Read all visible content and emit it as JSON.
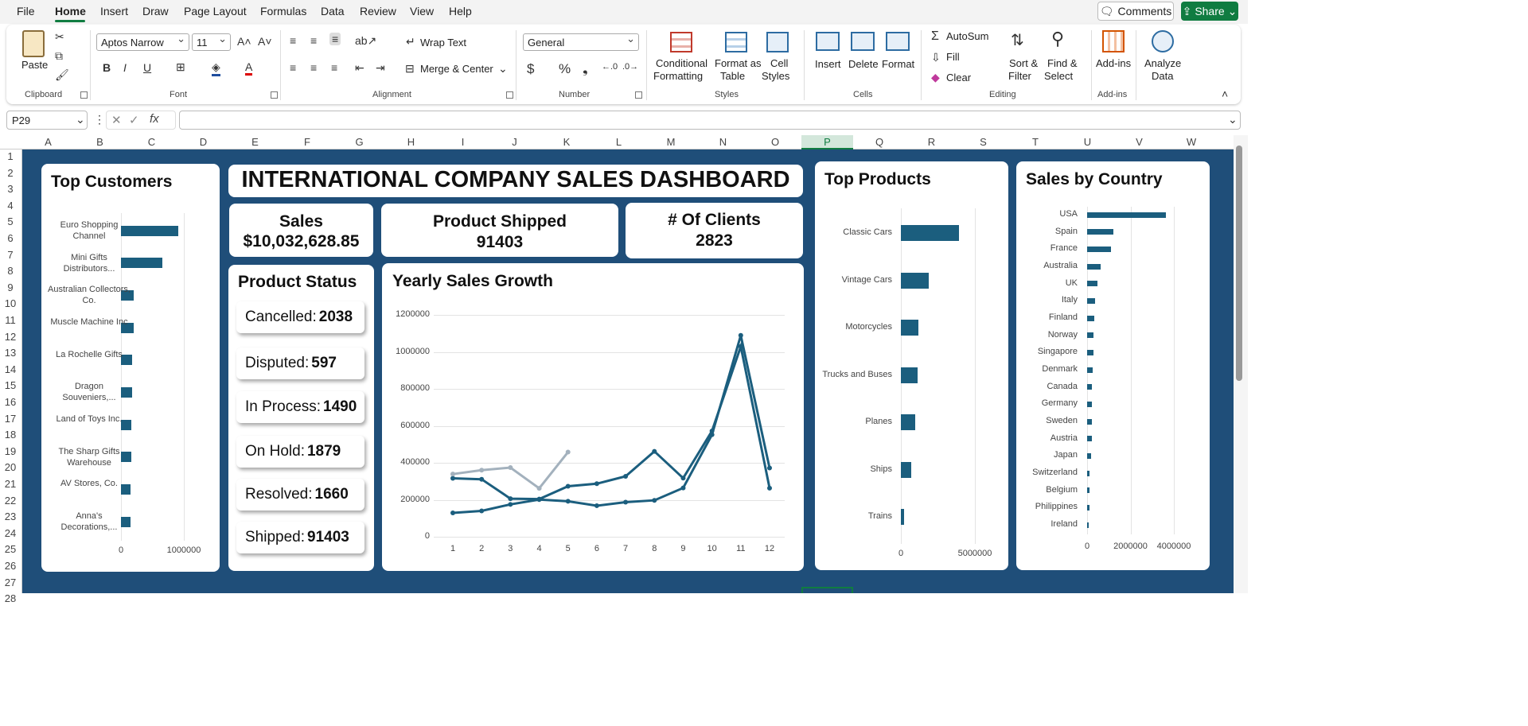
{
  "menu": [
    "File",
    "Home",
    "Insert",
    "Draw",
    "Page Layout",
    "Formulas",
    "Data",
    "Review",
    "View",
    "Help"
  ],
  "comments_label": "Comments",
  "share_label": "Share",
  "ribbon": {
    "paste": "Paste",
    "clipboard": "Clipboard",
    "font_name": "Aptos Narrow",
    "font_size": "11",
    "font": "Font",
    "wrap_text": "Wrap Text",
    "merge_center": "Merge & Center",
    "alignment": "Alignment",
    "number_format": "General",
    "number": "Number",
    "conditional": "Conditional",
    "formatting": "Formatting",
    "format_as": "Format as",
    "table": "Table",
    "cell": "Cell",
    "styles_lbl": "Styles",
    "styles": "Styles",
    "insert": "Insert",
    "delete": "Delete",
    "format": "Format",
    "cells": "Cells",
    "autosum": "AutoSum",
    "fill": "Fill",
    "clear": "Clear",
    "sort": "Sort &",
    "filter": "Filter",
    "find": "Find &",
    "select": "Select",
    "editing": "Editing",
    "addins": "Add-ins",
    "addins_group": "Add-ins",
    "analyze": "Analyze",
    "data": "Data"
  },
  "namebox": "P29",
  "columns": [
    "A",
    "B",
    "C",
    "D",
    "E",
    "F",
    "G",
    "H",
    "I",
    "J",
    "K",
    "L",
    "M",
    "N",
    "O",
    "P",
    "Q",
    "R",
    "S",
    "T",
    "U",
    "V",
    "W"
  ],
  "rows": [
    "1",
    "2",
    "3",
    "4",
    "5",
    "6",
    "7",
    "8",
    "9",
    "10",
    "11",
    "12",
    "13",
    "14",
    "15",
    "16",
    "17",
    "18",
    "19",
    "20",
    "21",
    "22",
    "23",
    "24",
    "25",
    "26",
    "27",
    "28"
  ],
  "dashboard": {
    "title": "INTERNATIONAL COMPANY SALES DASHBOARD",
    "sales_label": "Sales",
    "sales_value": "$10,032,628.85",
    "shipped_label": "Product Shipped",
    "shipped_value": "91403",
    "clients_label": "# Of Clients",
    "clients_value": "2823",
    "status_title": "Product Status",
    "status": [
      {
        "label": "Cancelled:",
        "value": "2038"
      },
      {
        "label": "Disputed:",
        "value": "597"
      },
      {
        "label": "In Process:",
        "value": "1490"
      },
      {
        "label": "On Hold:",
        "value": "1879"
      },
      {
        "label": "Resolved:",
        "value": "1660"
      },
      {
        "label": "Shipped:",
        "value": "91403"
      }
    ],
    "customers_title": "Top Customers",
    "growth_title": "Yearly Sales Growth",
    "products_title": "Top Products",
    "country_title": "Sales by Country"
  },
  "colors": {
    "bar": "#1b5e7e",
    "line_dark": "#1b5e7e",
    "line_light": "#a3b1bd",
    "sheet": "#1f4e79",
    "accent": "#107c41"
  },
  "chart_data": [
    {
      "type": "bar",
      "title": "Top Customers",
      "orientation": "horizontal",
      "categories": [
        "Euro Shopping Channel",
        "Mini Gifts Distributors...",
        "Australian Collectors, Co.",
        "Muscle Machine Inc",
        "La Rochelle Gifts",
        "Dragon Souveniers,...",
        "Land of Toys Inc.",
        "The Sharp Gifts Warehouse",
        "AV Stores, Co.",
        "Anna's Decorations,..."
      ],
      "values": [
        912000,
        655000,
        200000,
        197000,
        180000,
        172000,
        164000,
        160000,
        157000,
        153000
      ],
      "xlim": [
        0,
        1000000
      ],
      "xticks": [
        "0",
        "1000000"
      ]
    },
    {
      "type": "line",
      "title": "Yearly Sales Growth",
      "x": [
        1,
        2,
        3,
        4,
        5,
        6,
        7,
        8,
        9,
        10,
        11,
        12
      ],
      "series": [
        {
          "values": [
            129000,
            140000,
            175000,
            201000,
            192000,
            168000,
            187000,
            197000,
            264000,
            552000,
            1089000,
            372000
          ]
        },
        {
          "values": [
            316000,
            311000,
            206000,
            204000,
            273000,
            287000,
            327000,
            462000,
            317000,
            572000,
            1029000,
            263000
          ]
        },
        {
          "values": [
            339000,
            360000,
            374000,
            262000,
            458000
          ]
        }
      ],
      "ylim": [
        0,
        1200000
      ],
      "yticks": [
        "0",
        "200000",
        "400000",
        "600000",
        "800000",
        "1000000",
        "1200000"
      ],
      "xticks": [
        "1",
        "2",
        "3",
        "4",
        "5",
        "6",
        "7",
        "8",
        "9",
        "10",
        "11",
        "12"
      ]
    },
    {
      "type": "bar",
      "title": "Top Products",
      "orientation": "horizontal",
      "categories": [
        "Classic Cars",
        "Vintage Cars",
        "Motorcycles",
        "Trucks and Buses",
        "Planes",
        "Ships",
        "Trains"
      ],
      "values": [
        3920000,
        1900000,
        1170000,
        1130000,
        975000,
        714000,
        226000
      ],
      "xlim": [
        0,
        5000000
      ],
      "xticks": [
        "0",
        "5000000"
      ]
    },
    {
      "type": "bar",
      "title": "Sales by Country",
      "orientation": "horizontal",
      "categories": [
        "USA",
        "Spain",
        "France",
        "Australia",
        "UK",
        "Italy",
        "Finland",
        "Norway",
        "Singapore",
        "Denmark",
        "Canada",
        "Germany",
        "Sweden",
        "Austria",
        "Japan",
        "Switzerland",
        "Belgium",
        "Philippines",
        "Ireland"
      ],
      "values": [
        3630000,
        1220000,
        1110000,
        630000,
        479000,
        375000,
        330000,
        307000,
        288000,
        246000,
        224000,
        221000,
        210000,
        202000,
        188000,
        117000,
        109000,
        94000,
        57000
      ],
      "xlim": [
        0,
        4000000
      ],
      "xticks": [
        "0",
        "2000000",
        "4000000"
      ]
    }
  ]
}
